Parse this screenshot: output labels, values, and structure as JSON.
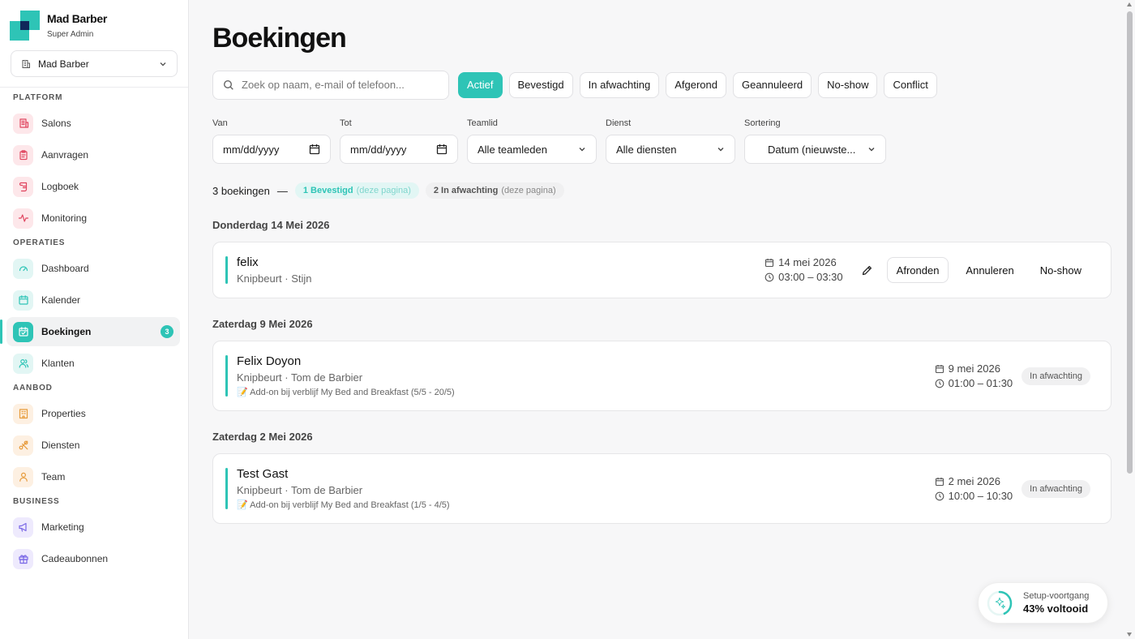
{
  "brand": {
    "name": "Mad Barber",
    "role": "Super Admin"
  },
  "salon_select": {
    "value": "Mad Barber"
  },
  "sidebar": {
    "sections": [
      {
        "label": "PLATFORM",
        "items": [
          {
            "label": "Salons",
            "icon": "building-icon",
            "color": "pink"
          },
          {
            "label": "Aanvragen",
            "icon": "clipboard-icon",
            "color": "pink"
          },
          {
            "label": "Logboek",
            "icon": "scroll-icon",
            "color": "pink"
          },
          {
            "label": "Monitoring",
            "icon": "activity-icon",
            "color": "pink"
          }
        ]
      },
      {
        "label": "OPERATIES",
        "items": [
          {
            "label": "Dashboard",
            "icon": "gauge-icon",
            "color": "teal"
          },
          {
            "label": "Kalender",
            "icon": "calendar-icon",
            "color": "teal"
          },
          {
            "label": "Boekingen",
            "icon": "calendar-check-icon",
            "color": "teal",
            "active": true,
            "badge": "3"
          },
          {
            "label": "Klanten",
            "icon": "users-icon",
            "color": "teal"
          }
        ]
      },
      {
        "label": "AANBOD",
        "items": [
          {
            "label": "Properties",
            "icon": "hotel-icon",
            "color": "orange"
          },
          {
            "label": "Diensten",
            "icon": "scissors-icon",
            "color": "orange"
          },
          {
            "label": "Team",
            "icon": "user-icon",
            "color": "orange"
          }
        ]
      },
      {
        "label": "BUSINESS",
        "items": [
          {
            "label": "Marketing",
            "icon": "megaphone-icon",
            "color": "purple"
          },
          {
            "label": "Cadeaubonnen",
            "icon": "gift-icon",
            "color": "purple"
          }
        ]
      }
    ]
  },
  "page": {
    "title": "Boekingen"
  },
  "search": {
    "placeholder": "Zoek op naam, e-mail of telefoon...",
    "value": ""
  },
  "status_filters": [
    {
      "label": "Actief",
      "active": true
    },
    {
      "label": "Bevestigd"
    },
    {
      "label": "In afwachting"
    },
    {
      "label": "Afgerond"
    },
    {
      "label": "Geannuleerd"
    },
    {
      "label": "No-show"
    },
    {
      "label": "Conflict"
    }
  ],
  "filters": {
    "van": {
      "label": "Van",
      "value": "mm/dd/yyyy"
    },
    "tot": {
      "label": "Tot",
      "value": "mm/dd/yyyy"
    },
    "teamlid": {
      "label": "Teamlid",
      "value": "Alle teamleden"
    },
    "dienst": {
      "label": "Dienst",
      "value": "Alle diensten"
    },
    "sortering": {
      "label": "Sortering",
      "value": "Datum (nieuwste..."
    }
  },
  "summary": {
    "count": "3 boekingen",
    "dash": "—",
    "confirmed": "1 Bevestigd",
    "confirmed_sub": "(deze pagina)",
    "pending": "2 In afwachting",
    "pending_sub": "(deze pagina)"
  },
  "days": [
    {
      "heading": "Donderdag 14 Mei 2026",
      "bookings": [
        {
          "name": "felix",
          "service": "Knipbeurt · Stijn",
          "note": "",
          "date": "14 mei 2026",
          "time": "03:00 – 03:30",
          "actions": [
            "Afronden",
            "Annuleren",
            "No-show"
          ],
          "status": ""
        }
      ]
    },
    {
      "heading": "Zaterdag 9 Mei 2026",
      "bookings": [
        {
          "name": "Felix Doyon",
          "service": "Knipbeurt · Tom de Barbier",
          "note": "📝 Add-on bij verblijf My Bed and Breakfast (5/5 - 20/5)",
          "date": "9 mei 2026",
          "time": "01:00 – 01:30",
          "actions": [],
          "status": "In afwachting"
        }
      ]
    },
    {
      "heading": "Zaterdag 2 Mei 2026",
      "bookings": [
        {
          "name": "Test Gast",
          "service": "Knipbeurt · Tom de Barbier",
          "note": "📝 Add-on bij verblijf My Bed and Breakfast (1/5 - 4/5)",
          "date": "2 mei 2026",
          "time": "10:00 – 10:30",
          "actions": [],
          "status": "In afwachting"
        }
      ]
    }
  ],
  "setup": {
    "label": "Setup-voortgang",
    "value": "43% voltooid",
    "progress": 0.43
  },
  "colors": {
    "accent": "#2ec4b6",
    "navy": "#10285a"
  }
}
